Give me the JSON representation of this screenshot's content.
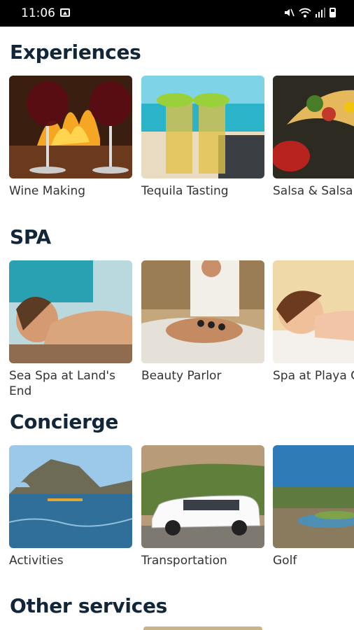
{
  "status_bar": {
    "time": "11:06"
  },
  "sections": [
    {
      "title": "Experiences",
      "items": [
        {
          "label": "Wine Making",
          "image": "wine-glasses-fireplace"
        },
        {
          "label": "Tequila Tasting",
          "image": "tequila-shots-beach"
        },
        {
          "label": "Salsa & Salsa",
          "image": "tacos-salsa"
        }
      ]
    },
    {
      "title": "SPA",
      "items": [
        {
          "label": "Sea Spa at Land's End",
          "image": "massage-woman"
        },
        {
          "label": "Beauty Parlor",
          "image": "hot-stone-massage"
        },
        {
          "label": "Spa at Playa G",
          "image": "spa-woman-relaxing"
        }
      ]
    },
    {
      "title": "Concierge",
      "items": [
        {
          "label": "Activities",
          "image": "arch-kayaks"
        },
        {
          "label": "Transportation",
          "image": "white-minivan"
        },
        {
          "label": "Golf",
          "image": "golf-course-sea"
        }
      ]
    },
    {
      "title": "Other services",
      "items": []
    }
  ]
}
